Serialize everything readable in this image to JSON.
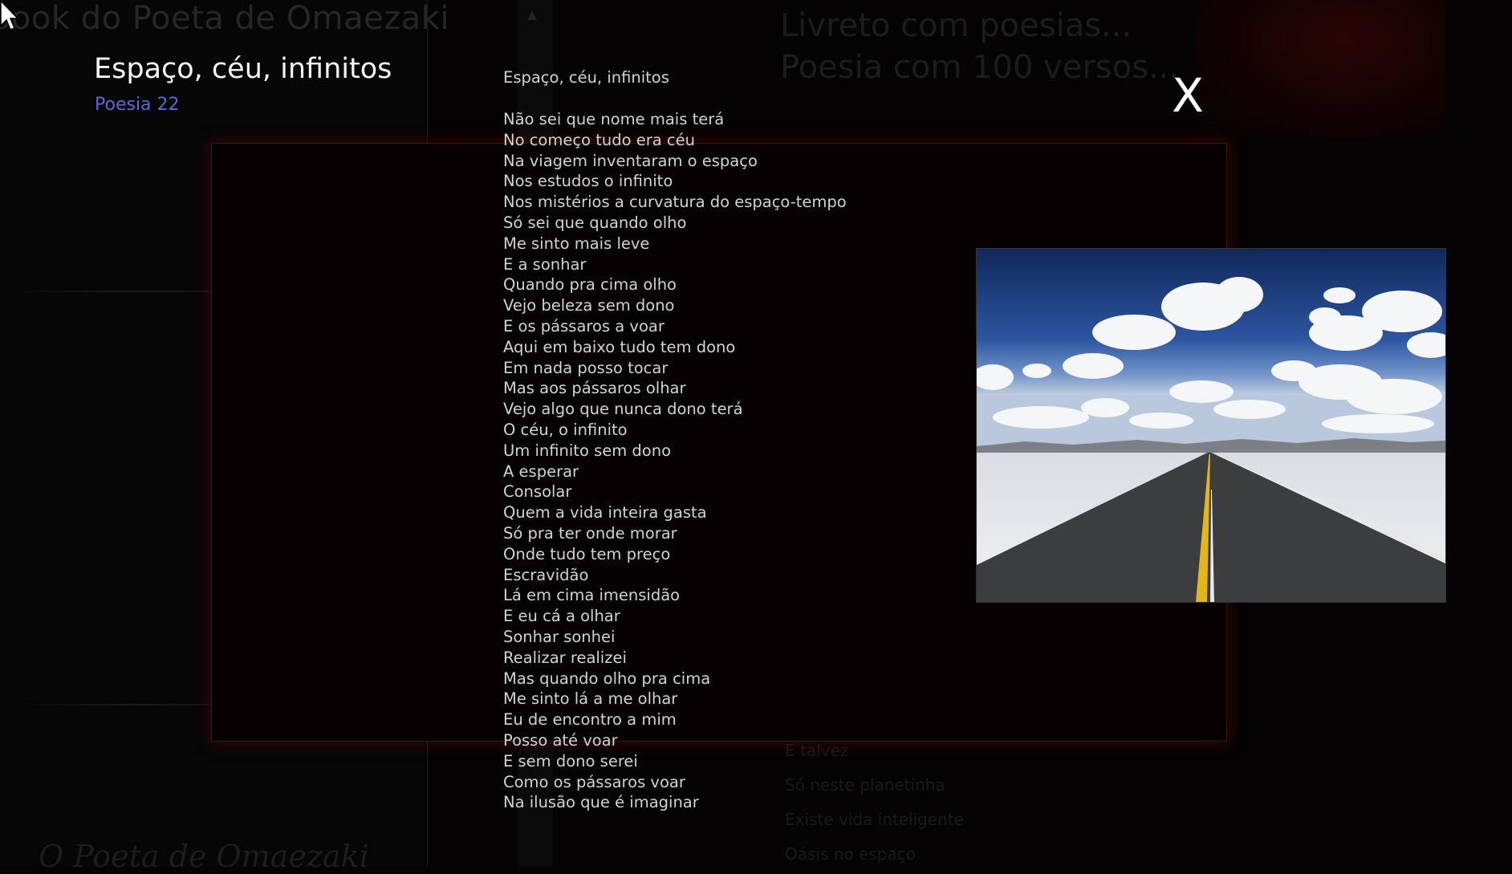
{
  "background": {
    "site_title": "book do Poeta de Omaezaki",
    "footer_title": "O Poeta de Omaezaki",
    "right_title_lines": [
      "Livreto com poesias...",
      "Poesia com 100 versos..."
    ],
    "list_items": [
      "E talvez",
      "Só neste planetinha",
      "Existe vida inteligente",
      "Oásis no espaço"
    ]
  },
  "modal": {
    "title": "Espaço, céu, infinitos",
    "subtitle": "Poesia 22",
    "close_label": "X",
    "poem_title": "Espaço, céu, infinitos",
    "poem_lines": [
      "Não sei que nome mais terá",
      "No começo tudo era céu",
      "Na viagem inventaram o espaço",
      "Nos estudos o infinito",
      "Nos mistérios a curvatura do espaço-tempo",
      "Só sei que quando olho",
      "Me sinto mais leve",
      "E a sonhar",
      "Quando pra cima olho",
      "Vejo beleza sem dono",
      "E os pássaros a voar",
      "Aqui em baixo tudo tem dono",
      "Em nada posso tocar",
      "Mas aos pássaros olhar",
      "Vejo algo que nunca dono terá",
      "O céu, o infinito",
      "Um infinito sem dono",
      "A esperar",
      "Consolar",
      "Quem a vida inteira gasta",
      "Só pra ter onde morar",
      "Onde tudo tem preço",
      "Escravidão",
      "Lá em cima imensidão",
      "E eu cá a olhar",
      "Sonhar sonhei",
      "Realizar realizei",
      "Mas quando olho pra cima",
      "Me sinto lá a me olhar",
      "Eu de encontro a mim",
      "Posso até voar",
      "E sem dono serei",
      "Como os pássaros voar",
      "Na ilusão que é imaginar"
    ],
    "image_icon": "road-sky-photo"
  },
  "colors": {
    "background": "#050304",
    "title": "#f4f4f4",
    "subtitle": "#5b6ad2",
    "poem_text": "#d2d2d2",
    "frame_glow": "#780a0a"
  }
}
